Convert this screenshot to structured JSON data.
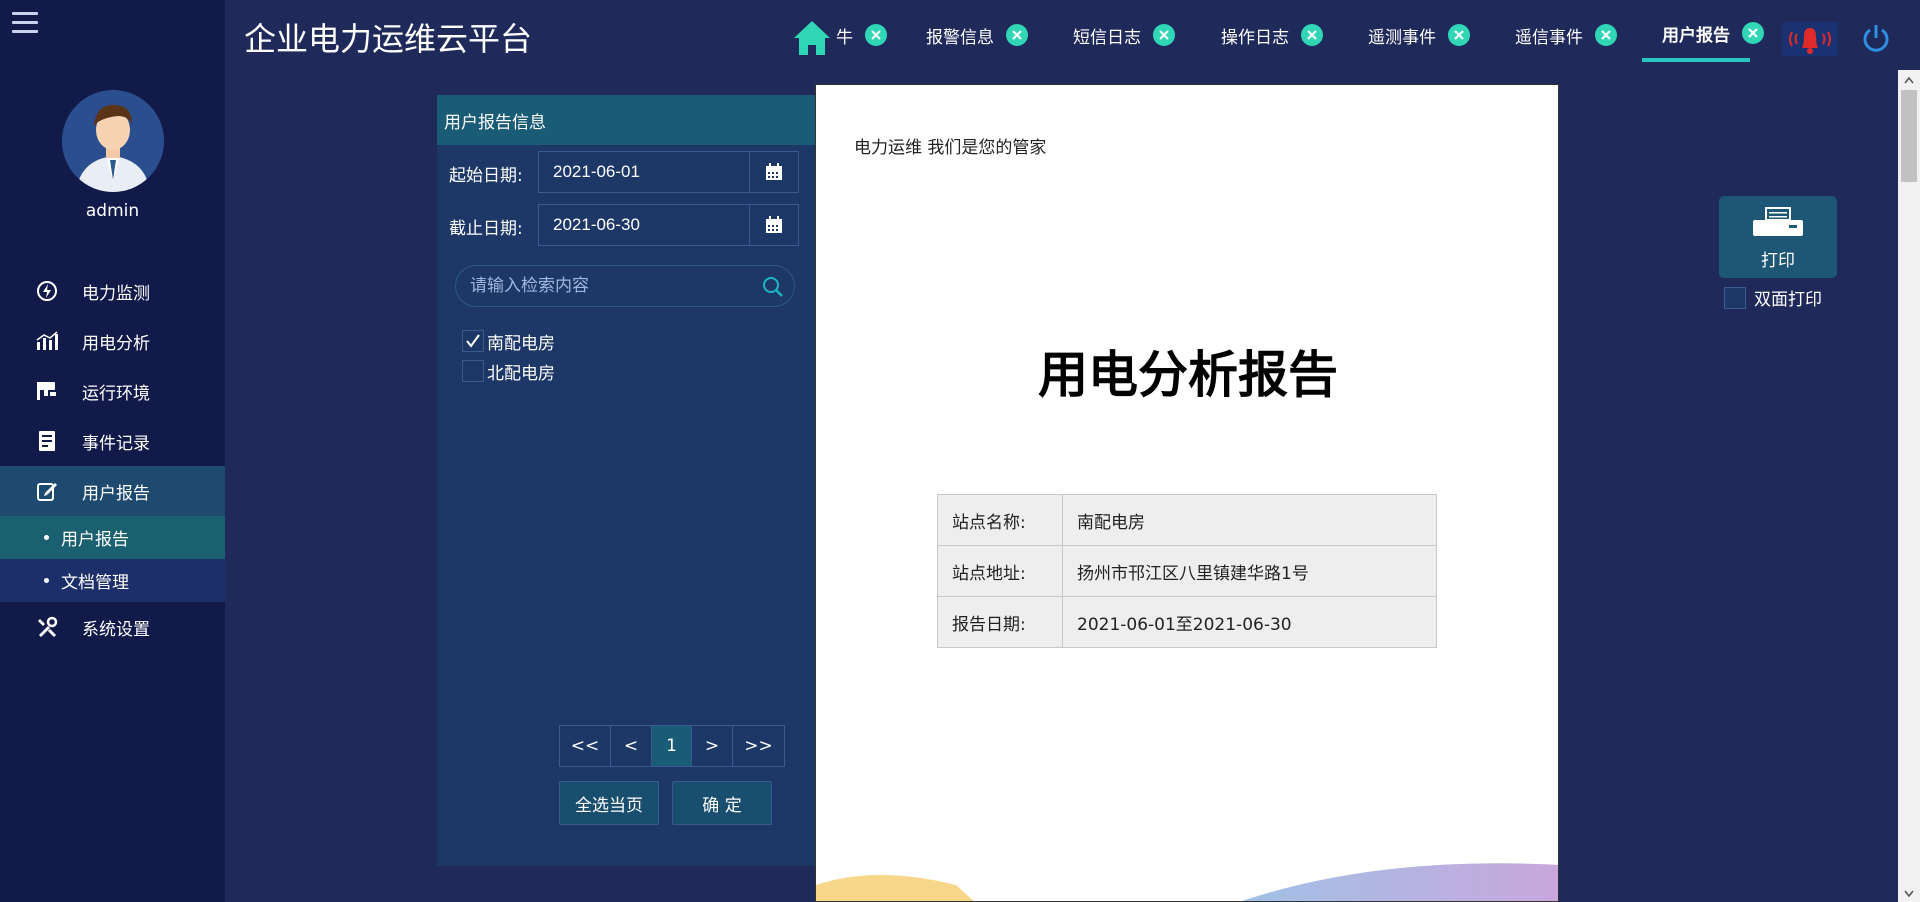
{
  "app": {
    "title": "企业电力运维云平台"
  },
  "user": {
    "name": "admin"
  },
  "sidebar": {
    "items": [
      {
        "label": "电力监测",
        "icon": "power-monitor-icon"
      },
      {
        "label": "用电分析",
        "icon": "bar-chart-icon"
      },
      {
        "label": "运行环境",
        "icon": "camera-icon"
      },
      {
        "label": "事件记录",
        "icon": "record-icon"
      },
      {
        "label": "用户报告",
        "icon": "edit-icon"
      },
      {
        "label": "系统设置",
        "icon": "tools-icon"
      }
    ],
    "subitems": [
      {
        "label": "用户报告"
      },
      {
        "label": "文档管理"
      }
    ]
  },
  "tabs": [
    {
      "label": "牛"
    },
    {
      "label": "报警信息"
    },
    {
      "label": "短信日志"
    },
    {
      "label": "操作日志"
    },
    {
      "label": "遥测事件"
    },
    {
      "label": "遥信事件"
    },
    {
      "label": "用户报告"
    }
  ],
  "panel": {
    "title": "用户报告信息",
    "start_label": "起始日期:",
    "start_value": "2021-06-01",
    "end_label": "截止日期:",
    "end_value": "2021-06-30",
    "search_placeholder": "请输入检索内容",
    "stations": [
      {
        "label": "南配电房",
        "checked": true
      },
      {
        "label": "北配电房",
        "checked": false
      }
    ],
    "pager": {
      "first": "<<",
      "prev": "<",
      "current": "1",
      "next": ">",
      "last": ">>"
    },
    "select_all": "全选当页",
    "confirm": "确 定"
  },
  "report": {
    "slogan": "电力运维 我们是您的管家",
    "title": "用电分析报告",
    "rows": [
      {
        "key": "站点名称:",
        "value": "南配电房"
      },
      {
        "key": "站点地址:",
        "value": "扬州市邗江区八里镇建华路1号"
      },
      {
        "key": "报告日期:",
        "value": "2021-06-01至2021-06-30"
      }
    ]
  },
  "print": {
    "label": "打印",
    "duplex_label": "双面打印",
    "duplex_checked": false
  },
  "colors": {
    "accent": "#25c7c0",
    "tab_close": "#30d6b6",
    "sidebar_bg": "#121a4a",
    "body_bg": "#1f2a5a"
  }
}
